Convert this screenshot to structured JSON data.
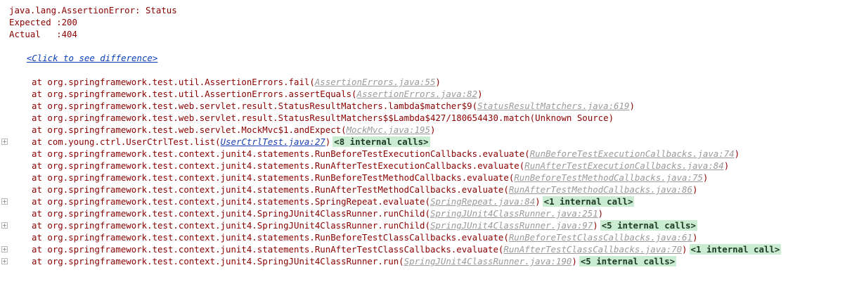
{
  "error": {
    "title": "java.lang.AssertionError: Status",
    "expected": "Expected :200",
    "actual": "Actual   :404",
    "diff_link": "<Click to see difference>"
  },
  "frames": [
    {
      "method": "at org.springframework.test.util.AssertionErrors.fail(",
      "source": "AssertionErrors.java:55",
      "tail": ")",
      "internal": "",
      "foldable": false,
      "highlight": false
    },
    {
      "method": "at org.springframework.test.util.AssertionErrors.assertEquals(",
      "source": "AssertionErrors.java:82",
      "tail": ")",
      "internal": "",
      "foldable": false,
      "highlight": false
    },
    {
      "method": "at org.springframework.test.web.servlet.result.StatusResultMatchers.lambda$matcher$9(",
      "source": "StatusResultMatchers.java:619",
      "tail": ")",
      "internal": "",
      "foldable": false,
      "highlight": false
    },
    {
      "method": "at org.springframework.test.web.servlet.result.StatusResultMatchers$$Lambda$427/180654430.match(Unknown Source)",
      "source": "",
      "tail": "",
      "internal": "",
      "foldable": false,
      "highlight": false
    },
    {
      "method": "at org.springframework.test.web.servlet.MockMvc$1.andExpect(",
      "source": "MockMvc.java:195",
      "tail": ")",
      "internal": "",
      "foldable": false,
      "highlight": false
    },
    {
      "method": "at com.young.ctrl.UserCtrlTest.list(",
      "source": "UserCtrlTest.java:27",
      "tail": ")",
      "internal": "<8 internal calls>",
      "foldable": true,
      "highlight": true
    },
    {
      "method": "at org.springframework.test.context.junit4.statements.RunBeforeTestExecutionCallbacks.evaluate(",
      "source": "RunBeforeTestExecutionCallbacks.java:74",
      "tail": ")",
      "internal": "",
      "foldable": false,
      "highlight": false
    },
    {
      "method": "at org.springframework.test.context.junit4.statements.RunAfterTestExecutionCallbacks.evaluate(",
      "source": "RunAfterTestExecutionCallbacks.java:84",
      "tail": ")",
      "internal": "",
      "foldable": false,
      "highlight": false
    },
    {
      "method": "at org.springframework.test.context.junit4.statements.RunBeforeTestMethodCallbacks.evaluate(",
      "source": "RunBeforeTestMethodCallbacks.java:75",
      "tail": ")",
      "internal": "",
      "foldable": false,
      "highlight": false
    },
    {
      "method": "at org.springframework.test.context.junit4.statements.RunAfterTestMethodCallbacks.evaluate(",
      "source": "RunAfterTestMethodCallbacks.java:86",
      "tail": ")",
      "internal": "",
      "foldable": false,
      "highlight": false
    },
    {
      "method": "at org.springframework.test.context.junit4.statements.SpringRepeat.evaluate(",
      "source": "SpringRepeat.java:84",
      "tail": ")",
      "internal": "<1 internal call>",
      "foldable": true,
      "highlight": false
    },
    {
      "method": "at org.springframework.test.context.junit4.SpringJUnit4ClassRunner.runChild(",
      "source": "SpringJUnit4ClassRunner.java:251",
      "tail": ")",
      "internal": "",
      "foldable": false,
      "highlight": false
    },
    {
      "method": "at org.springframework.test.context.junit4.SpringJUnit4ClassRunner.runChild(",
      "source": "SpringJUnit4ClassRunner.java:97",
      "tail": ")",
      "internal": "<5 internal calls>",
      "foldable": true,
      "highlight": false
    },
    {
      "method": "at org.springframework.test.context.junit4.statements.RunBeforeTestClassCallbacks.evaluate(",
      "source": "RunBeforeTestClassCallbacks.java:61",
      "tail": ")",
      "internal": "",
      "foldable": false,
      "highlight": false
    },
    {
      "method": "at org.springframework.test.context.junit4.statements.RunAfterTestClassCallbacks.evaluate(",
      "source": "RunAfterTestClassCallbacks.java:70",
      "tail": ")",
      "internal": "<1 internal call>",
      "foldable": true,
      "highlight": false
    },
    {
      "method": "at org.springframework.test.context.junit4.SpringJUnit4ClassRunner.run(",
      "source": "SpringJUnit4ClassRunner.java:190",
      "tail": ")",
      "internal": "<5 internal calls>",
      "foldable": true,
      "highlight": false
    }
  ]
}
